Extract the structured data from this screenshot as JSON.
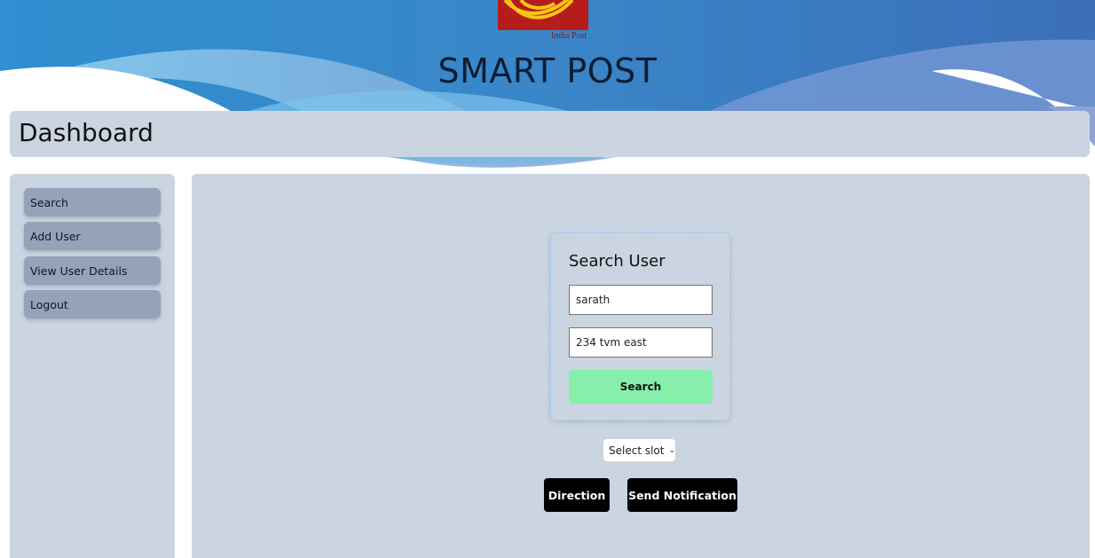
{
  "header": {
    "logo_caption": "India Post",
    "app_title": "SMART POST",
    "brand_colors": {
      "logo_red": "#b71c1c",
      "logo_yellow": "#f5c518",
      "wave_blue": "#3b82c4"
    }
  },
  "dashboard": {
    "title": "Dashboard"
  },
  "sidebar": {
    "items": [
      {
        "label": "Search"
      },
      {
        "label": "Add User"
      },
      {
        "label": "View User Details"
      },
      {
        "label": "Logout"
      }
    ]
  },
  "search_card": {
    "title": "Search User",
    "name_value": "sarath",
    "address_value": "234 tvm east",
    "search_label": "Search"
  },
  "slot": {
    "selected": "Select slot"
  },
  "actions": {
    "direction_label": "Direction",
    "notify_label": "Send Notification"
  },
  "icons": [
    "india-post-logo",
    "chevron-down-icon"
  ]
}
